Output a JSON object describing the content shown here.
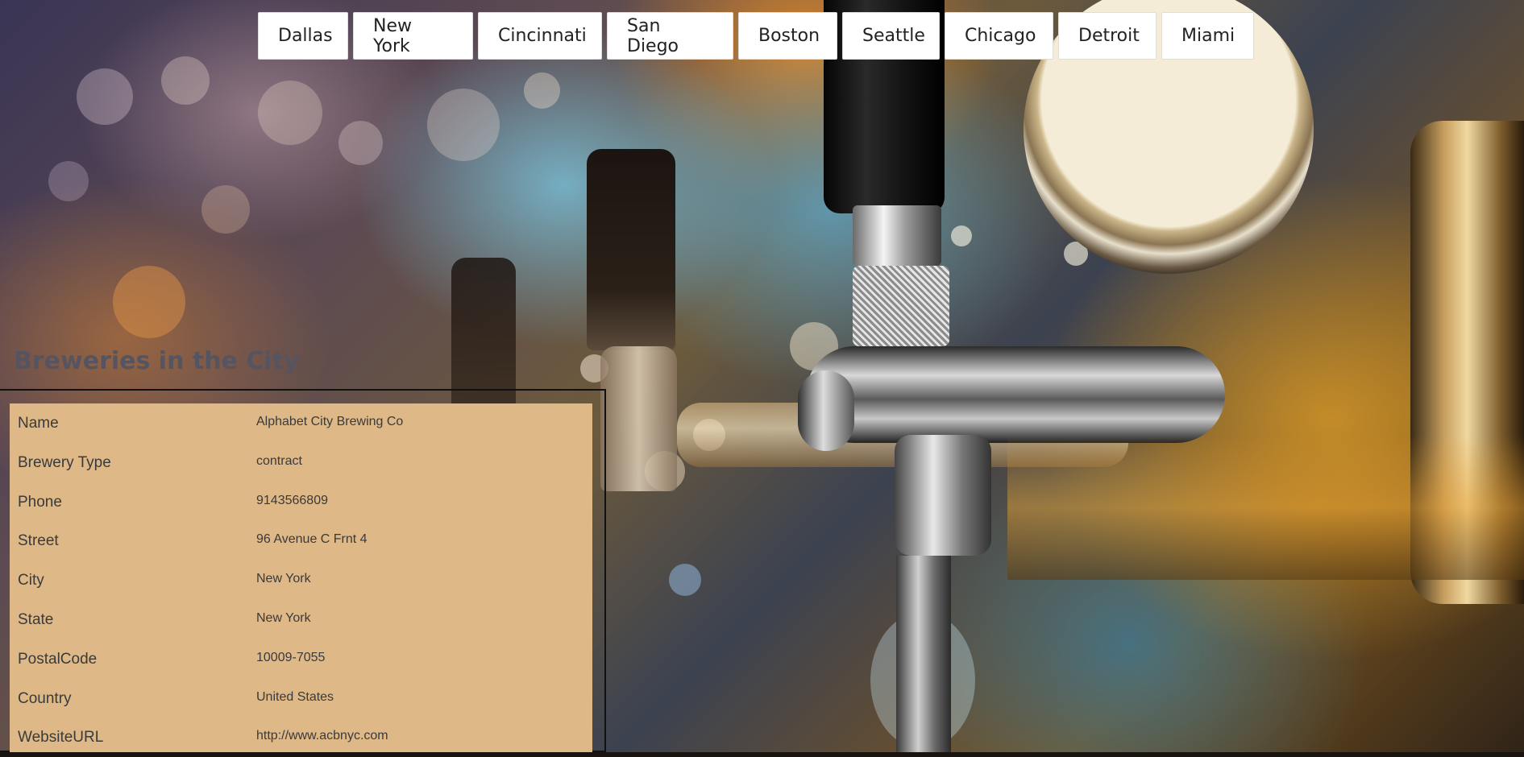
{
  "nav": {
    "cities": [
      "Dallas",
      "New York",
      "Cincinnati",
      "San Diego",
      "Boston",
      "Seattle",
      "Chicago",
      "Detroit",
      "Miami"
    ]
  },
  "section": {
    "title": "Breweries in the City"
  },
  "brewery": {
    "fields": [
      {
        "label": "Name",
        "value": "Alphabet City Brewing Co"
      },
      {
        "label": "Brewery Type",
        "value": "contract"
      },
      {
        "label": "Phone",
        "value": "9143566809"
      },
      {
        "label": "Street",
        "value": "96 Avenue C Frnt 4"
      },
      {
        "label": "City",
        "value": "New York"
      },
      {
        "label": "State",
        "value": "New York"
      },
      {
        "label": "PostalCode",
        "value": "10009-7055"
      },
      {
        "label": "Country",
        "value": "United States"
      },
      {
        "label": "WebsiteURL",
        "value": "http://www.acbnyc.com"
      }
    ]
  },
  "colors": {
    "card_background": "#deb887",
    "title_color": "#555460",
    "button_background": "#ffffff"
  }
}
